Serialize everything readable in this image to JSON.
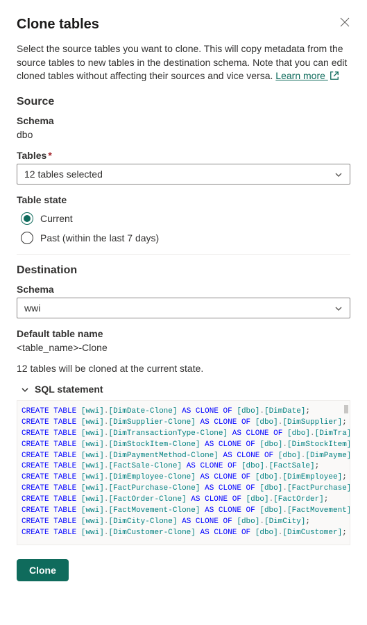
{
  "header": {
    "title": "Clone tables",
    "description": "Select the source tables you want to clone. This will copy metadata from the source tables to new tables in the destination schema. Note that you can edit cloned tables without affecting their sources and vice versa.",
    "learn_more": "Learn more"
  },
  "source": {
    "heading": "Source",
    "schema_label": "Schema",
    "schema_value": "dbo",
    "tables_label": "Tables",
    "tables_value": "12 tables selected",
    "state_label": "Table state",
    "radio_current": "Current",
    "radio_past": "Past (within the last 7 days)",
    "state_selected": "current"
  },
  "destination": {
    "heading": "Destination",
    "schema_label": "Schema",
    "schema_value": "wwi",
    "default_name_label": "Default table name",
    "default_name_value": "<table_name>-Clone"
  },
  "summary": "12 tables will be cloned at the current state.",
  "sql": {
    "heading": "SQL statement",
    "dest_schema": "wwi",
    "src_schema": "dbo",
    "rows": [
      {
        "dest": "DimDate-Clone",
        "src": "DimDate",
        "truncated": false
      },
      {
        "dest": "DimSupplier-Clone",
        "src": "DimSupplier",
        "truncated": false
      },
      {
        "dest": "DimTransactionType-Clone",
        "src": "DimTra",
        "truncated": true
      },
      {
        "dest": "DimStockItem-Clone",
        "src": "DimStockItem",
        "truncated": true
      },
      {
        "dest": "DimPaymentMethod-Clone",
        "src": "DimPayme",
        "truncated": true
      },
      {
        "dest": "FactSale-Clone",
        "src": "FactSale",
        "truncated": false
      },
      {
        "dest": "DimEmployee-Clone",
        "src": "DimEmployee",
        "truncated": false
      },
      {
        "dest": "FactPurchase-Clone",
        "src": "FactPurchase",
        "truncated": true
      },
      {
        "dest": "FactOrder-Clone",
        "src": "FactOrder",
        "truncated": false
      },
      {
        "dest": "FactMovement-Clone",
        "src": "FactMovement",
        "truncated": true
      },
      {
        "dest": "DimCity-Clone",
        "src": "DimCity",
        "truncated": false
      },
      {
        "dest": "DimCustomer-Clone",
        "src": "DimCustomer",
        "truncated": false
      }
    ]
  },
  "footer": {
    "clone_button": "Clone"
  }
}
